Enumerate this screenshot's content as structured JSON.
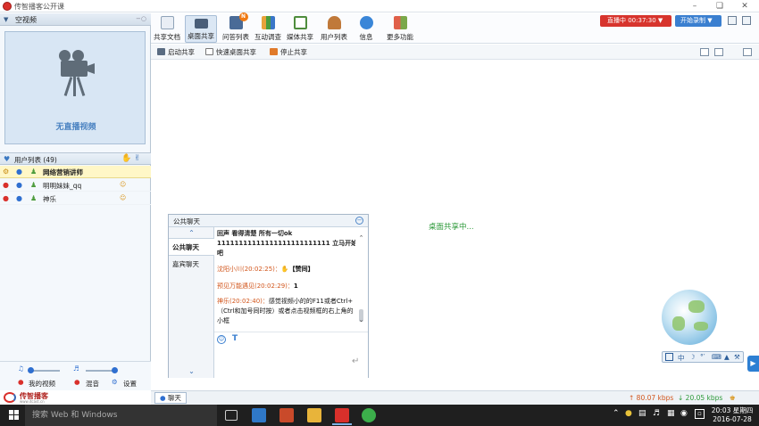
{
  "window": {
    "title": "传智播客公开课",
    "controls": [
      "–",
      "❏",
      "✕"
    ]
  },
  "side_panel": {
    "camera_header": "空视频",
    "no_video_text": "无直播视频",
    "user_list": {
      "title": "用户列表 (49)",
      "users": [
        {
          "name": "网络营销讲师",
          "selected": true
        },
        {
          "name": "明明妹妹_qq",
          "selected": false
        },
        {
          "name": "神乐",
          "selected": false
        }
      ]
    },
    "controls": {
      "my_video": "我的视频",
      "mix": "混音",
      "settings": "设置"
    },
    "brand": {
      "name": "传智播客",
      "url": "www.itcast.cn"
    }
  },
  "toolbar": {
    "tools": [
      {
        "label": "共享文档",
        "icon": "document-icon",
        "color": "#e9eef5"
      },
      {
        "label": "桌面共享",
        "icon": "desktop-share-icon",
        "color": "#4a5e78",
        "active": true
      },
      {
        "label": "问答列表",
        "icon": "qa-list-icon",
        "color": "#4a6b97",
        "badge": "N"
      },
      {
        "label": "互动调查",
        "icon": "survey-icon",
        "color": "#e8a23a"
      },
      {
        "label": "媒体共享",
        "icon": "media-share-icon",
        "color": "#4f8d3d"
      },
      {
        "label": "用户列表",
        "icon": "user-list-icon",
        "color": "#c0793a"
      },
      {
        "label": "信息",
        "icon": "info-icon",
        "color": "#3a86d8"
      },
      {
        "label": "更多功能",
        "icon": "more-icon",
        "color": "#7aa84a"
      }
    ],
    "live_button": "直播中 00:37:30 ▼",
    "record_button": "开始录制 ▼"
  },
  "subtoolbar": {
    "start_share": "启动共享",
    "quick_share": "快速桌面共享",
    "stop_share": "停止共享"
  },
  "desktop_status": "桌面共享中...",
  "chat": {
    "title": "公共聊天",
    "tabs": [
      "公共聊天",
      "嘉宾聊天"
    ],
    "messages": [
      {
        "text": "回声 看得清楚 所有一切ok"
      },
      {
        "text": "11111111111111111111111111 立马开始吧"
      },
      {
        "name": "沈阳小川",
        "time": "(20:02:25)：",
        "text": "【赞同】"
      },
      {
        "name": "预见万能遇见",
        "time": "(20:02:29)：",
        "text": "1"
      },
      {
        "name": "神乐",
        "time": "(20:02:40)：",
        "text": "感觉视频小的的F11或者Ctrl+（Ctrl和加号同时按）或者点击视频框的右上角的小框"
      }
    ],
    "font_tool": "T"
  },
  "statusbar": {
    "chat_toggle": "聊天",
    "upload": "↑ 80.07 kbps",
    "download": "↓ 20.05 kbps"
  },
  "globe_tools": [
    "中",
    "☽",
    "°′",
    "⌨",
    "▲",
    "⚒"
  ],
  "taskbar": {
    "search_placeholder": "搜索 Web 和 Windows",
    "time": "20:03 星期四",
    "date": "2016-07-28"
  }
}
